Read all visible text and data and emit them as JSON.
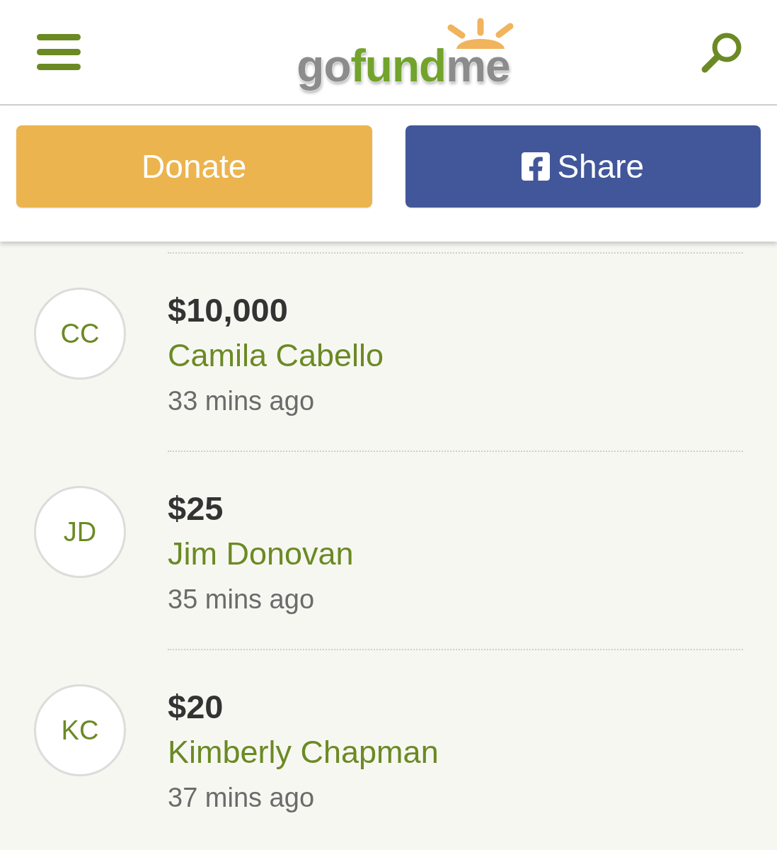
{
  "header": {
    "logo": {
      "segments": [
        "go",
        "fund",
        "me"
      ]
    }
  },
  "actions": [
    {
      "kind": "donate",
      "label": "Donate"
    },
    {
      "kind": "share",
      "label": "Share"
    }
  ],
  "donations": [
    {
      "initials": "CC",
      "amount": "$10,000",
      "name": "Camila Cabello",
      "time": "33 mins ago"
    },
    {
      "initials": "JD",
      "amount": "$25",
      "name": "Jim Donovan",
      "time": "35 mins ago"
    },
    {
      "initials": "KC",
      "amount": "$20",
      "name": "Kimberly Chapman",
      "time": "37 mins ago"
    }
  ]
}
